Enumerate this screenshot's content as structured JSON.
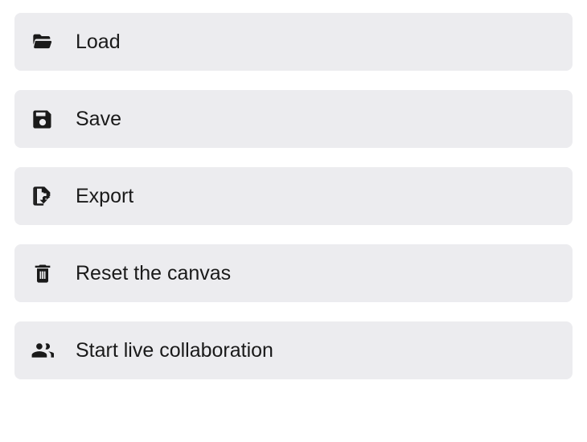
{
  "menu": {
    "items": [
      {
        "label": "Load"
      },
      {
        "label": "Save"
      },
      {
        "label": "Export"
      },
      {
        "label": "Reset the canvas"
      },
      {
        "label": "Start live collaboration"
      }
    ]
  }
}
